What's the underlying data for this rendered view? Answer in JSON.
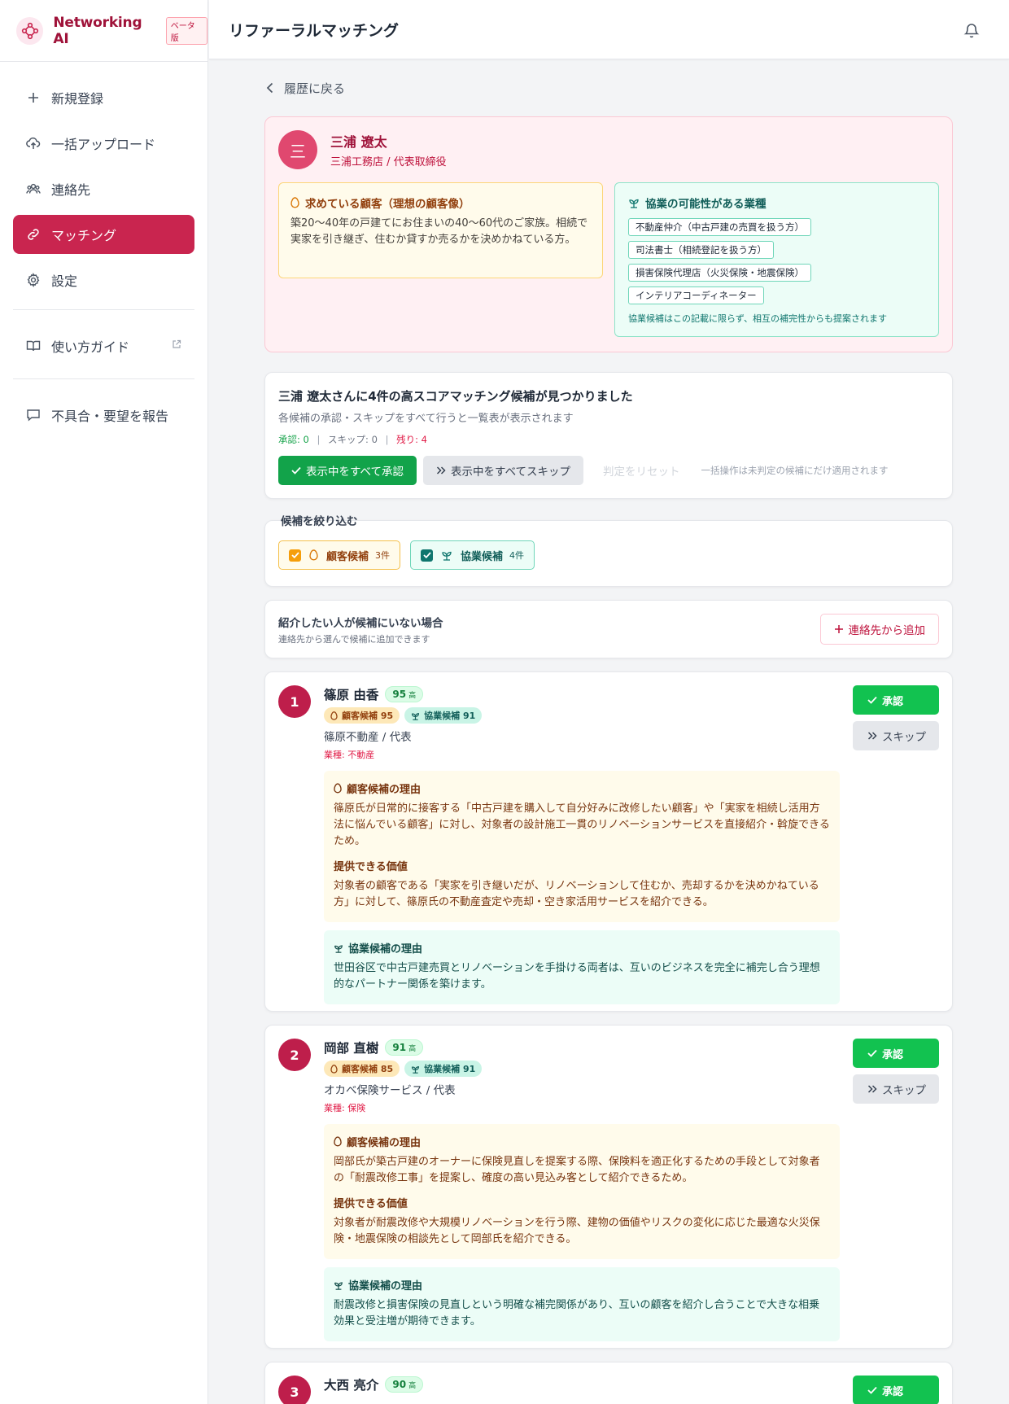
{
  "app": {
    "name": "Networking AI",
    "beta_label": "ベータ版",
    "page_title": "リファーラルマッチング"
  },
  "sidebar": {
    "items": [
      {
        "label": "新規登録",
        "icon": "plus-icon"
      },
      {
        "label": "一括アップロード",
        "icon": "cloud-upload-icon"
      },
      {
        "label": "連絡先",
        "icon": "users-icon"
      },
      {
        "label": "マッチング",
        "icon": "link-icon",
        "active": true
      },
      {
        "label": "設定",
        "icon": "gear-icon"
      }
    ],
    "guide": "使い方ガイド",
    "report": "不具合・要望を報告"
  },
  "back_label": "履歴に戻る",
  "profile": {
    "initial": "三",
    "name": "三浦 遼太",
    "company": "三浦工務店 / 代表取締役",
    "ideal_title": "求めている顧客（理想の顧客像）",
    "ideal_text": "築20〜40年の戸建てにお住まいの40〜60代のご家族。相続で実家を引き継ぎ、住むか貸すか売るかを決めかねている方。",
    "collab_title": "協業の可能性がある業種",
    "collab_tags": [
      "不動産仲介（中古戸建の売買を扱う方）",
      "司法書士（相続登記を扱う方）",
      "損害保険代理店（火災保険・地震保険）",
      "インテリアコーディネーター"
    ],
    "collab_note": "協業候補はこの記載に限らず、相互の補完性からも提案されます"
  },
  "summary": {
    "title": "三浦 遼太さんに4件の高スコアマッチング候補が見つかりました",
    "subtitle": "各候補の承認・スキップをすべて行うと一覧表が表示されます",
    "approved": "承認: 0",
    "skipped": "スキップ: 0",
    "remaining": "残り: 4",
    "approve_all": "表示中をすべて承認",
    "skip_all": "表示中をすべてスキップ",
    "reset": "判定をリセット",
    "bulk_note": "一括操作は未判定の候補にだけ適用されます"
  },
  "filter": {
    "label": "候補を絞り込む",
    "customer_label": "顧客候補",
    "customer_count": "3件",
    "collab_label": "協業候補",
    "collab_count": "4件"
  },
  "not_in_list": {
    "title": "紹介したい人が候補にいない場合",
    "subtitle": "連絡先から選んで候補に追加できます",
    "add_button": "連絡先から追加"
  },
  "labels": {
    "approve": "承認",
    "skip": "スキップ",
    "high": "高",
    "cust_reason": "顧客候補の理由",
    "value": "提供できる価値",
    "coll_reason": "協業候補の理由"
  },
  "candidates": [
    {
      "rank": "1",
      "name": "篠原 由香",
      "score": "95",
      "customer_badge": "顧客候補 95",
      "collab_badge": "協業候補 91",
      "company": "篠原不動産 / 代表",
      "industry": "業種: 不動産",
      "cust_reason": "篠原氏が日常的に接客する「中古戸建を購入して自分好みに改修したい顧客」や「実家を相続し活用方法に悩んでいる顧客」に対し、対象者の設計施工一貫のリノベーションサービスを直接紹介・斡旋できるため。",
      "value": "対象者の顧客である「実家を引き継いだが、リノベーションして住むか、売却するかを決めかねている方」に対して、篠原氏の不動産査定や売却・空き家活用サービスを紹介できる。",
      "coll_reason": "世田谷区で中古戸建売買とリノベーションを手掛ける両者は、互いのビジネスを完全に補完し合う理想的なパートナー関係を築けます。"
    },
    {
      "rank": "2",
      "name": "岡部 直樹",
      "score": "91",
      "customer_badge": "顧客候補 85",
      "collab_badge": "協業候補 91",
      "company": "オカベ保険サービス / 代表",
      "industry": "業種: 保険",
      "cust_reason": "岡部氏が築古戸建のオーナーに保険見直しを提案する際、保険料を適正化するための手段として対象者の「耐震改修工事」を提案し、確度の高い見込み客として紹介できるため。",
      "value": "対象者が耐震改修や大規模リノベーションを行う際、建物の価値やリスクの変化に応じた最適な火災保険・地震保険の相談先として岡部氏を紹介できる。",
      "coll_reason": "耐震改修と損害保険の見直しという明確な補完関係があり、互いの顧客を紹介し合うことで大きな相乗効果と受注増が期待できます。"
    },
    {
      "rank": "3",
      "name": "大西 亮介",
      "score": "90"
    }
  ],
  "colors": {
    "accent": "#c9254f",
    "approve": "#12c250",
    "customer": "#fffbeb",
    "collab": "#ecfdf7"
  }
}
